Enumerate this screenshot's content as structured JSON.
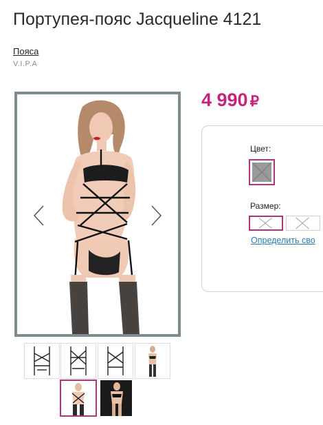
{
  "product": {
    "title": "Портупея-пояс Jacqueline 4121",
    "category_link": "Пояса",
    "brand": "V.I.P.A",
    "price_value": "4 990",
    "price_currency": "₽"
  },
  "options": {
    "color_label": "Цвет:",
    "size_label": "Размер:",
    "size_chart_link": "Определить сво"
  },
  "colors": {
    "accent": "#c4257a",
    "selection_border": "#b0357d",
    "image_frame": "#7f8b8f",
    "link": "#2a7ab0"
  },
  "gallery": {
    "thumbnail_count": 6,
    "selected_index": 4
  }
}
